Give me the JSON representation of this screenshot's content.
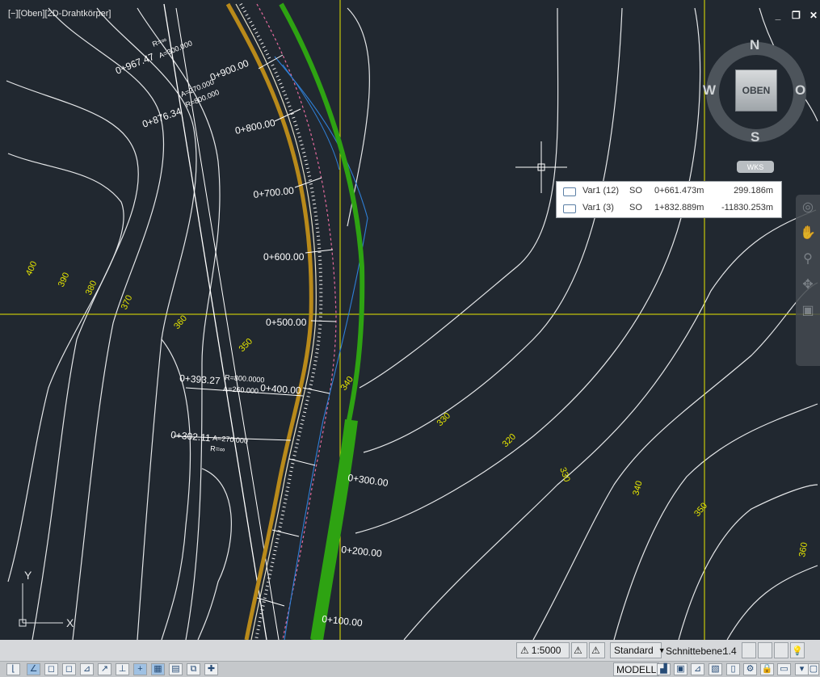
{
  "viewport": {
    "label": "[−][Oben][2D-Drahtkörper]",
    "controls": [
      "_",
      "❐",
      "✕"
    ]
  },
  "viewcube": {
    "face": "OBEN",
    "north": "N",
    "south": "S",
    "west": "W",
    "east": "O",
    "wcs": "WKS"
  },
  "tooltip": {
    "rows": [
      {
        "name": "Var1 (12)",
        "side": "SO",
        "station": "0+661.473m",
        "offset": "299.186m"
      },
      {
        "name": "Var1 (3)",
        "side": "SO",
        "station": "1+832.889m",
        "offset": "-11830.253m"
      }
    ]
  },
  "stations": [
    "0+967.47",
    "0+900.00",
    "0+876.34",
    "0+800.00",
    "0+700.00",
    "0+600.00",
    "0+500.00",
    "0+393.27",
    "0+400.00",
    "0+302.11",
    "0+300.00",
    "0+200.00",
    "0+100.00"
  ],
  "curve_labels": [
    "R=∞",
    "A=300.000",
    "A=270.000",
    "R=800.000",
    "R=800.0000",
    "A=260.000",
    "A=270.000",
    "R=∞"
  ],
  "contours": [
    "400",
    "390",
    "380",
    "370",
    "360",
    "350",
    "340",
    "330",
    "320",
    "330",
    "340",
    "350",
    "360"
  ],
  "ucs": {
    "x": "X",
    "y": "Y"
  },
  "colors": {
    "background": "#212830",
    "crosshair": "#e6e600",
    "contour_label": "#e6e600",
    "alignment_green": "#2ea312",
    "alignment_gold": "#b98a1a"
  },
  "status": {
    "scale": "1:5000",
    "visual_style": "Standard",
    "cut_plane_label": "Schnittebene:",
    "cut_plane_value": "1.4",
    "model_tab": "MODELL"
  }
}
